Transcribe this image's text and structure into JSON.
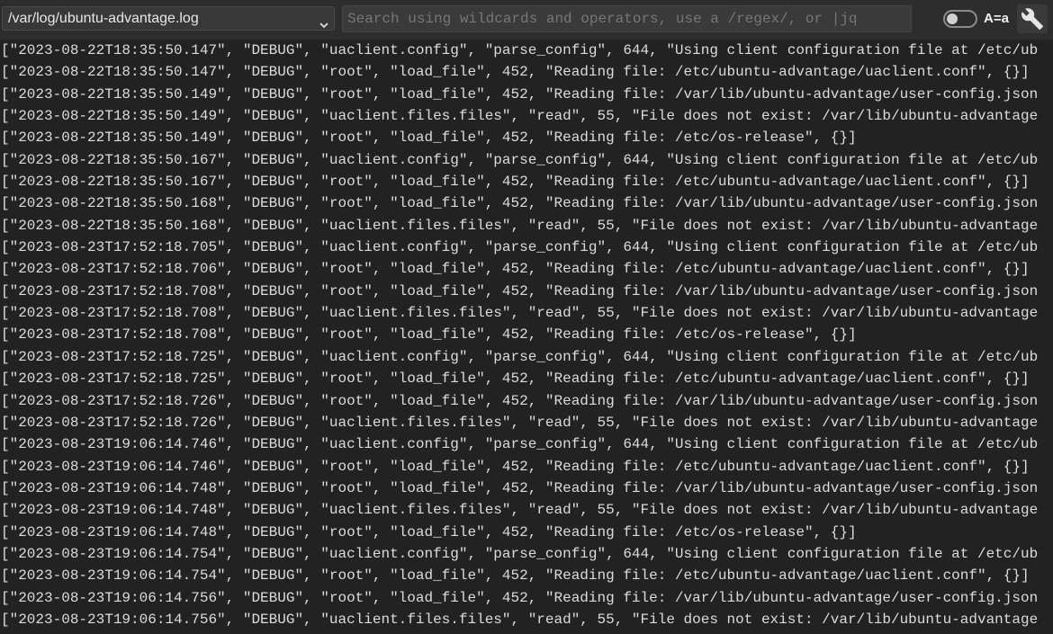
{
  "toolbar": {
    "file_select": "/var/log/ubuntu-advantage.log",
    "search_placeholder": "Search using wildcards and operators, use a /regex/, or |jq",
    "search_value": "",
    "case_toggle_on": false,
    "case_label": "A=a",
    "icons": {
      "dropdown": "chevron-down-icon",
      "settings": "wrench-icon"
    }
  },
  "colors": {
    "background": "#222222",
    "toolbar": "#2d2d2d",
    "text": "#dcdcdc",
    "placeholder": "#777777"
  },
  "log_lines": [
    "[\"2023-08-22T18:35:50.147\", \"DEBUG\", \"uaclient.config\", \"parse_config\", 644, \"Using client configuration file at /etc/ub",
    "[\"2023-08-22T18:35:50.147\", \"DEBUG\", \"root\", \"load_file\", 452, \"Reading file: /etc/ubuntu-advantage/uaclient.conf\", {}]",
    "[\"2023-08-22T18:35:50.149\", \"DEBUG\", \"root\", \"load_file\", 452, \"Reading file: /var/lib/ubuntu-advantage/user-config.json",
    "[\"2023-08-22T18:35:50.149\", \"DEBUG\", \"uaclient.files.files\", \"read\", 55, \"File does not exist: /var/lib/ubuntu-advantage",
    "[\"2023-08-22T18:35:50.149\", \"DEBUG\", \"root\", \"load_file\", 452, \"Reading file: /etc/os-release\", {}]",
    "[\"2023-08-22T18:35:50.167\", \"DEBUG\", \"uaclient.config\", \"parse_config\", 644, \"Using client configuration file at /etc/ub",
    "[\"2023-08-22T18:35:50.167\", \"DEBUG\", \"root\", \"load_file\", 452, \"Reading file: /etc/ubuntu-advantage/uaclient.conf\", {}]",
    "[\"2023-08-22T18:35:50.168\", \"DEBUG\", \"root\", \"load_file\", 452, \"Reading file: /var/lib/ubuntu-advantage/user-config.json",
    "[\"2023-08-22T18:35:50.168\", \"DEBUG\", \"uaclient.files.files\", \"read\", 55, \"File does not exist: /var/lib/ubuntu-advantage",
    "[\"2023-08-23T17:52:18.705\", \"DEBUG\", \"uaclient.config\", \"parse_config\", 644, \"Using client configuration file at /etc/ub",
    "[\"2023-08-23T17:52:18.706\", \"DEBUG\", \"root\", \"load_file\", 452, \"Reading file: /etc/ubuntu-advantage/uaclient.conf\", {}]",
    "[\"2023-08-23T17:52:18.708\", \"DEBUG\", \"root\", \"load_file\", 452, \"Reading file: /var/lib/ubuntu-advantage/user-config.json",
    "[\"2023-08-23T17:52:18.708\", \"DEBUG\", \"uaclient.files.files\", \"read\", 55, \"File does not exist: /var/lib/ubuntu-advantage",
    "[\"2023-08-23T17:52:18.708\", \"DEBUG\", \"root\", \"load_file\", 452, \"Reading file: /etc/os-release\", {}]",
    "[\"2023-08-23T17:52:18.725\", \"DEBUG\", \"uaclient.config\", \"parse_config\", 644, \"Using client configuration file at /etc/ub",
    "[\"2023-08-23T17:52:18.725\", \"DEBUG\", \"root\", \"load_file\", 452, \"Reading file: /etc/ubuntu-advantage/uaclient.conf\", {}]",
    "[\"2023-08-23T17:52:18.726\", \"DEBUG\", \"root\", \"load_file\", 452, \"Reading file: /var/lib/ubuntu-advantage/user-config.json",
    "[\"2023-08-23T17:52:18.726\", \"DEBUG\", \"uaclient.files.files\", \"read\", 55, \"File does not exist: /var/lib/ubuntu-advantage",
    "[\"2023-08-23T19:06:14.746\", \"DEBUG\", \"uaclient.config\", \"parse_config\", 644, \"Using client configuration file at /etc/ub",
    "[\"2023-08-23T19:06:14.746\", \"DEBUG\", \"root\", \"load_file\", 452, \"Reading file: /etc/ubuntu-advantage/uaclient.conf\", {}]",
    "[\"2023-08-23T19:06:14.748\", \"DEBUG\", \"root\", \"load_file\", 452, \"Reading file: /var/lib/ubuntu-advantage/user-config.json",
    "[\"2023-08-23T19:06:14.748\", \"DEBUG\", \"uaclient.files.files\", \"read\", 55, \"File does not exist: /var/lib/ubuntu-advantage",
    "[\"2023-08-23T19:06:14.748\", \"DEBUG\", \"root\", \"load_file\", 452, \"Reading file: /etc/os-release\", {}]",
    "[\"2023-08-23T19:06:14.754\", \"DEBUG\", \"uaclient.config\", \"parse_config\", 644, \"Using client configuration file at /etc/ub",
    "[\"2023-08-23T19:06:14.754\", \"DEBUG\", \"root\", \"load_file\", 452, \"Reading file: /etc/ubuntu-advantage/uaclient.conf\", {}]",
    "[\"2023-08-23T19:06:14.756\", \"DEBUG\", \"root\", \"load_file\", 452, \"Reading file: /var/lib/ubuntu-advantage/user-config.json",
    "[\"2023-08-23T19:06:14.756\", \"DEBUG\", \"uaclient.files.files\", \"read\", 55, \"File does not exist: /var/lib/ubuntu-advantage"
  ]
}
